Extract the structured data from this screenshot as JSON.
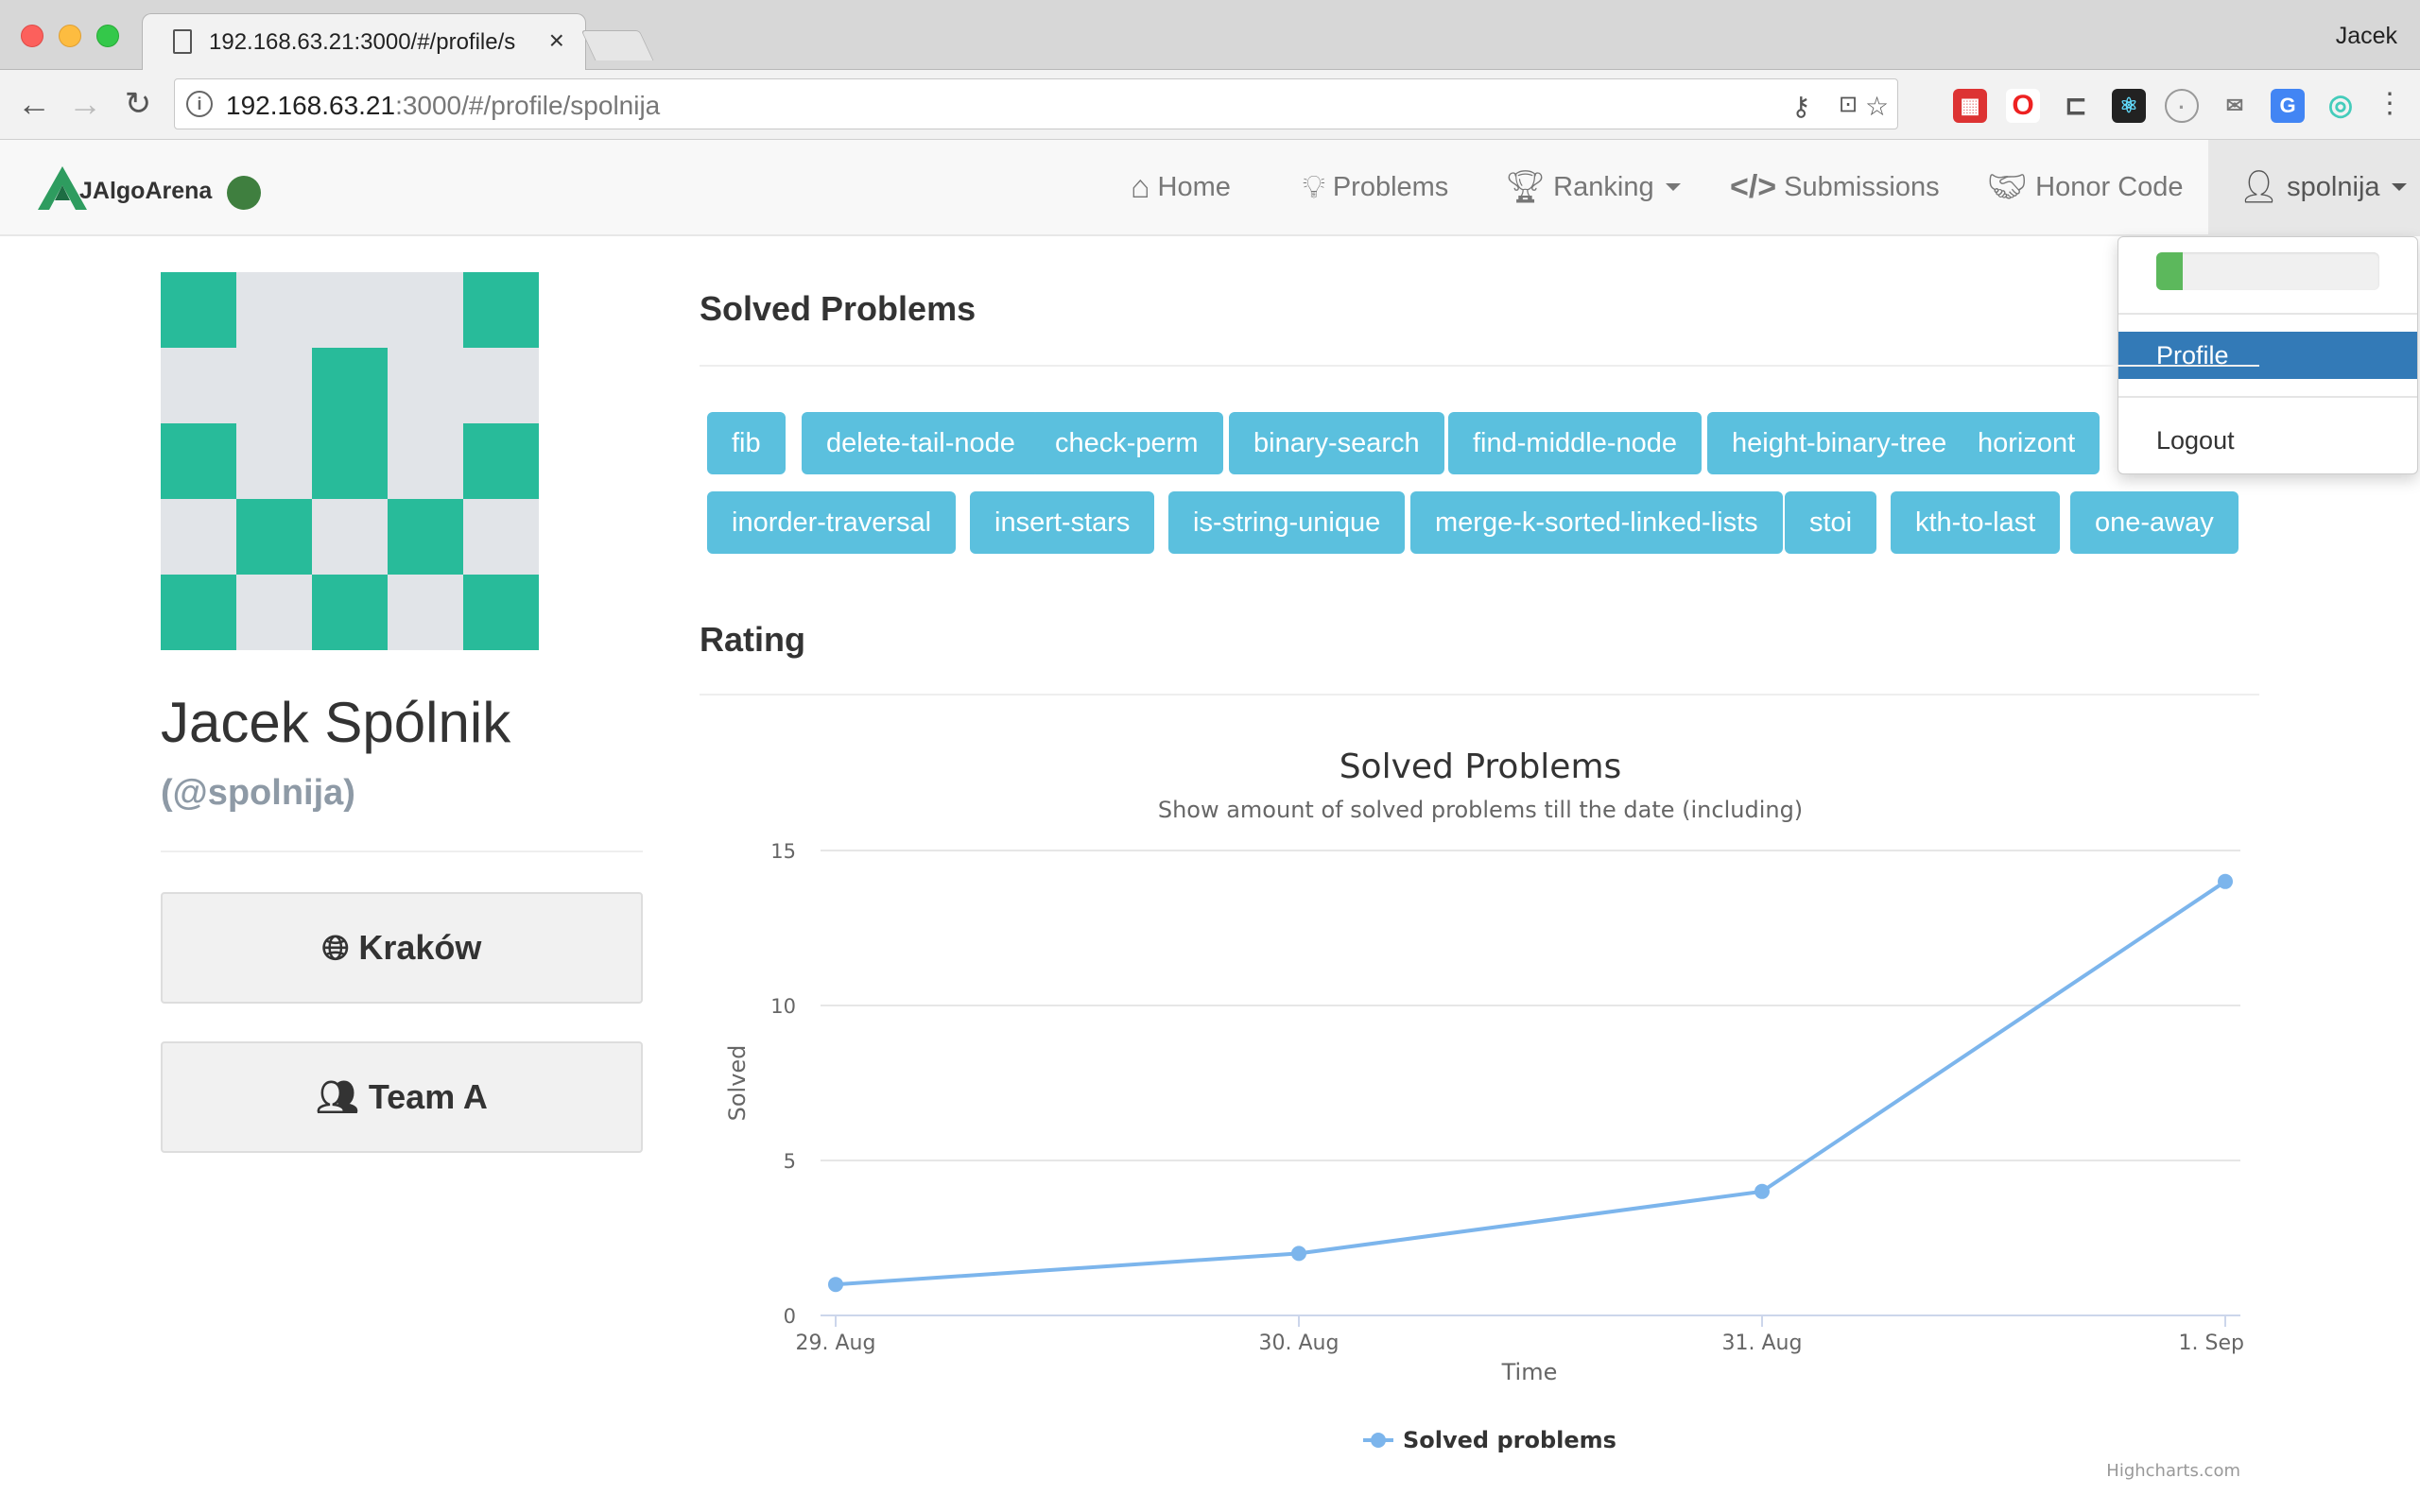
{
  "browser": {
    "tab_title": "192.168.63.21:3000/#/profile/s",
    "url_host": "192.168.63.21",
    "url_rest": ":3000/#/profile/spolnija",
    "profile_name": "Jacek"
  },
  "app": {
    "brand": "JAlgoArena",
    "nav": {
      "home": "Home",
      "problems": "Problems",
      "ranking": "Ranking",
      "submissions": "Submissions",
      "honor_code": "Honor Code",
      "user": "spolnija"
    },
    "dropdown": {
      "progress": 0.12,
      "profile": "Profile",
      "logout": "Logout"
    }
  },
  "profile": {
    "full_name": "Jacek Spólnik",
    "handle": "(@spolnija)",
    "city": "Kraków",
    "team": "Team A",
    "identicon_color": "#28bb9a",
    "identicon_bg": "#e1e4e8",
    "identicon_cells": [
      1,
      0,
      0,
      0,
      1,
      0,
      0,
      1,
      0,
      0,
      1,
      0,
      1,
      0,
      1,
      0,
      1,
      0,
      1,
      0,
      1,
      0,
      1,
      0,
      1
    ]
  },
  "solved_section": {
    "title": "Solved Problems",
    "problems": [
      "fib",
      "delete-tail-node",
      "check-perm",
      "binary-search",
      "find-middle-node",
      "height-binary-tree",
      "horizont",
      "inorder-traversal",
      "insert-stars",
      "is-string-unique",
      "merge-k-sorted-linked-lists",
      "stoi",
      "kth-to-last",
      "one-away"
    ]
  },
  "rating_section": {
    "title": "Rating"
  },
  "chart_data": {
    "type": "line",
    "title": "Solved Problems",
    "subtitle": "Show amount of solved problems till the date (including)",
    "xlabel": "Time",
    "ylabel": "Solved",
    "categories": [
      "29. Aug",
      "30. Aug",
      "31. Aug",
      "1. Sep"
    ],
    "yticks": [
      "0",
      "5",
      "10",
      "15"
    ],
    "ylim": [
      0,
      15
    ],
    "grid": true,
    "legend": "bottom-center",
    "series": [
      {
        "name": "Solved problems",
        "values": [
          1,
          2,
          4,
          14
        ],
        "color": "#7cb5ec"
      }
    ],
    "credits": "Highcharts.com"
  }
}
